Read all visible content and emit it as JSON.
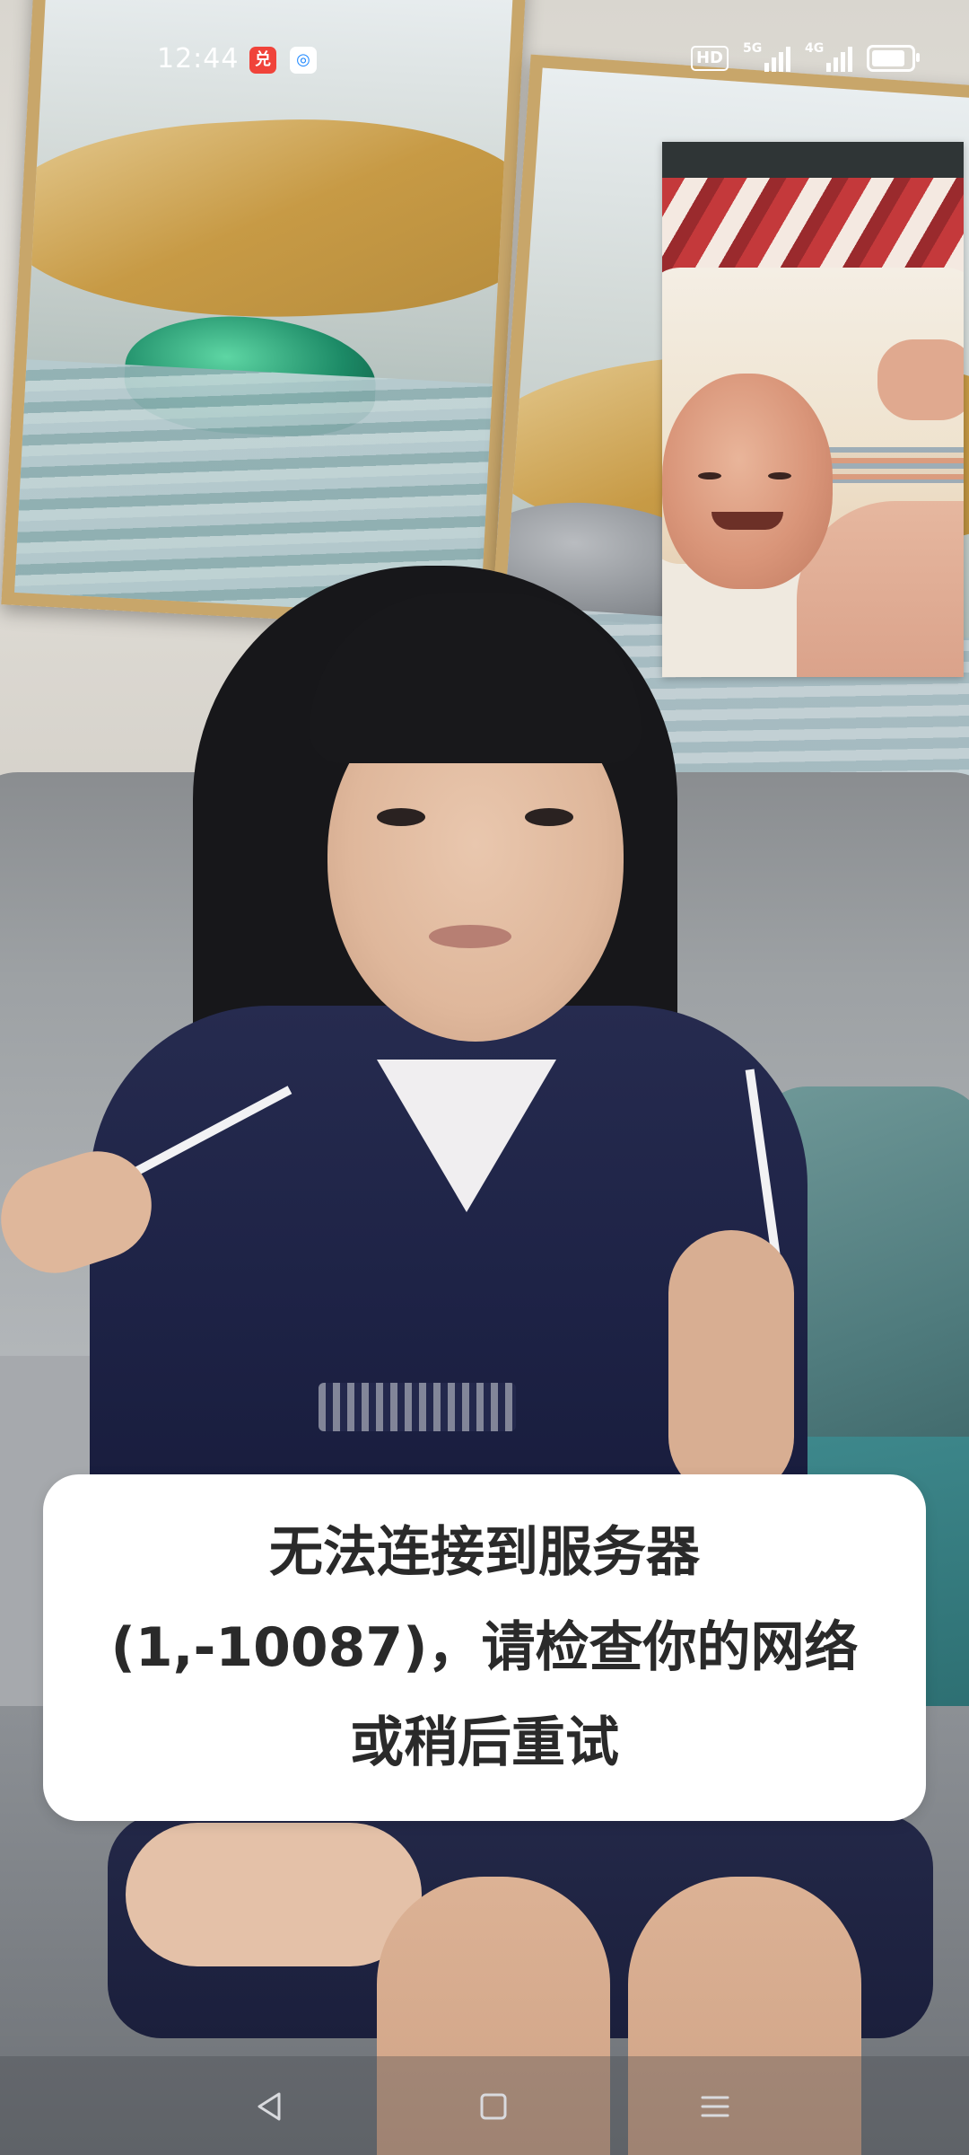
{
  "status_bar": {
    "time": "12:44",
    "app_icons": [
      "app-icon-red",
      "app-icon-blue"
    ],
    "hd_label": "HD",
    "network_1": "5G",
    "network_2": "4G",
    "battery_level": 0.75
  },
  "call": {
    "remote_video": "remote-participant-video",
    "local_preview": "local-camera-preview"
  },
  "toast": {
    "line1": "无法连接到服务器",
    "line2": "(1,-10087)，请检查你的网络",
    "line3": "或稍后重试"
  },
  "nav_bar": {
    "buttons": [
      "back-icon",
      "home-icon",
      "menu-icon"
    ]
  },
  "colors": {
    "toast_background": "#ffffff",
    "toast_text": "#2a2a2a",
    "status_text": "#ffffff"
  }
}
